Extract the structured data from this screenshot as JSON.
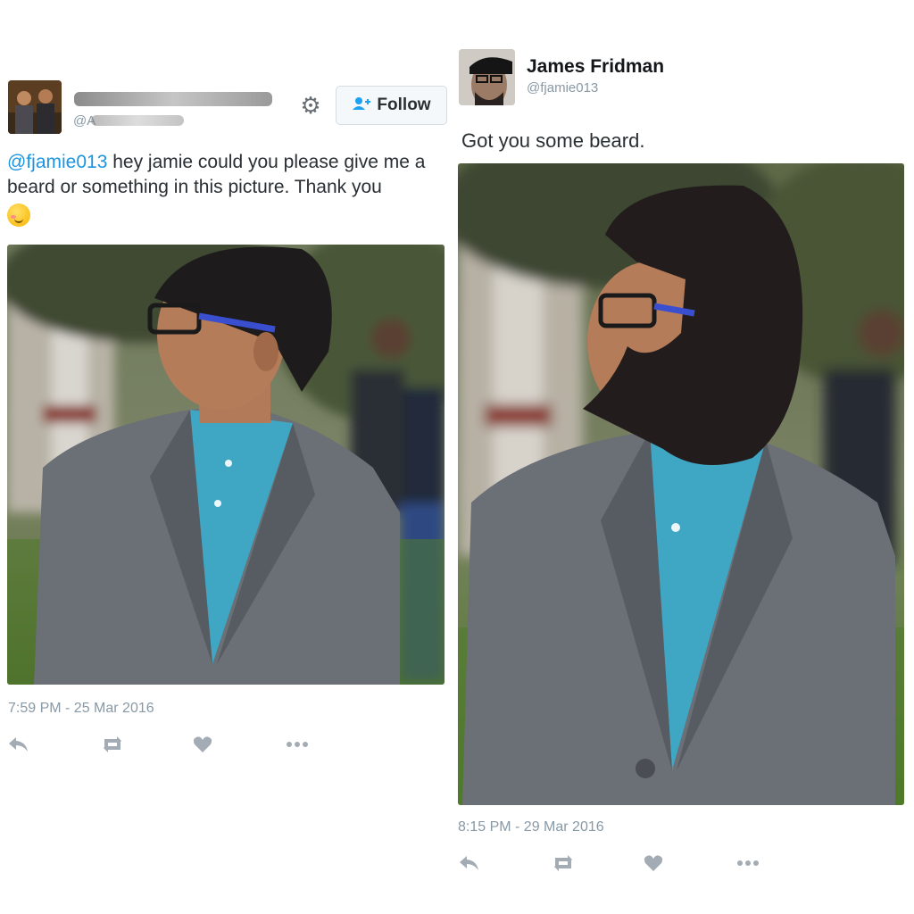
{
  "left_tweet": {
    "handle_fragment": "@A",
    "follow_label": "Follow",
    "text_mention": "@fjamie013",
    "text_body": " hey jamie could you please give me a beard or something in this picture. Thank you",
    "timestamp": "7:59 PM - 25 Mar 2016",
    "actions": {
      "reply_icon": "reply-icon",
      "retweet_icon": "retweet-icon",
      "like_icon": "heart-icon",
      "more_icon": "more-icon"
    }
  },
  "right_tweet": {
    "author_name": "James Fridman",
    "author_handle": "@fjamie013",
    "text": "Got you some beard.",
    "timestamp": "8:15 PM - 29 Mar 2016",
    "actions": {
      "reply_icon": "reply-icon",
      "retweet_icon": "retweet-icon",
      "like_icon": "heart-icon",
      "more_icon": "more-icon"
    }
  },
  "colors": {
    "link": "#1b95e0",
    "text": "#292f33",
    "muted": "#8899a6",
    "icon": "#a3acb4",
    "follow_icon": "#1da1f2"
  }
}
